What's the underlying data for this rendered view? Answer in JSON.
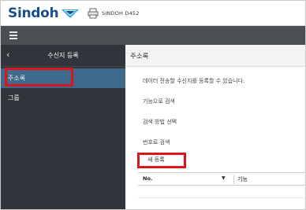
{
  "brand": {
    "logo_text": "Sindoh",
    "device_name": "SINDOH D452"
  },
  "sidebar": {
    "title": "수신지 등록",
    "items": [
      {
        "label": "주소록",
        "selected": true
      },
      {
        "label": "그룹",
        "selected": false
      }
    ]
  },
  "main": {
    "title": "주소록",
    "description": "데이터 전송할 수신지를 등록할 수 있습니다.",
    "options": [
      "기능으로 검색",
      "검색 방법 선택",
      "번호로 검색"
    ],
    "new_register_label": "새 등록",
    "table": {
      "columns": [
        "No.",
        "기능"
      ]
    }
  },
  "colors": {
    "brand_blue": "#1a4f8c",
    "toolbar": "#4a4f54",
    "sidebar_bg": "#2f353b",
    "sidebar_selected": "#3f6a8c",
    "highlight_red": "#d9161c"
  },
  "icons": [
    "sindoh-logo-icon",
    "printer-icon",
    "menu-icon",
    "back-arrow-icon",
    "sort-down-icon"
  ]
}
